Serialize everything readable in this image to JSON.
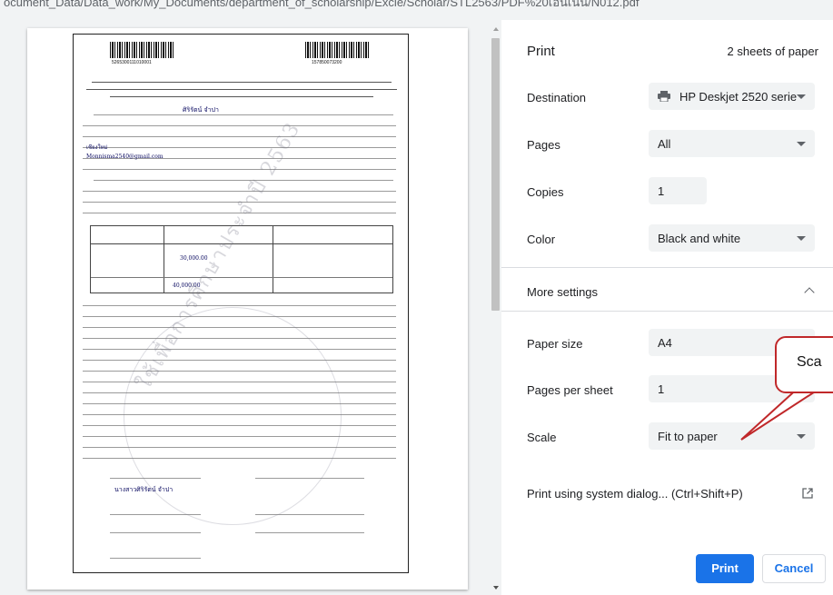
{
  "url_bar": {
    "text": "ocument_Data/Data_work/My_Documents/department_of_scholarship/Excle/Scholar/STL2563/PDF%20เอนเนน/N012.pdf"
  },
  "preview": {
    "barcode_left_number": "5265300111010001",
    "barcode_right_number": "157850073200",
    "watermark_text": "ใช้เพื่อการศึกษาประจำปี 2563",
    "handwritten": {
      "name": "ศิริรัตน์ จำปา",
      "email": "Monnisma2540@gmail.com",
      "amount_1": "30,000.00",
      "amount_2": "40,000.00",
      "signature": "นางสาวศิริรัตน์ จำปา",
      "district": "เชียงใหม่"
    }
  },
  "print_panel": {
    "title": "Print",
    "sheets": "2 sheets of paper",
    "destination": {
      "label": "Destination",
      "value": "HP Deskjet 2520 serie"
    },
    "pages": {
      "label": "Pages",
      "value": "All"
    },
    "copies": {
      "label": "Copies",
      "value": "1"
    },
    "color": {
      "label": "Color",
      "value": "Black and white"
    },
    "more_settings": {
      "label": "More settings"
    },
    "paper_size": {
      "label": "Paper size",
      "value": "A4"
    },
    "pages_per_sheet": {
      "label": "Pages per sheet",
      "value": "1"
    },
    "scale": {
      "label": "Scale",
      "value": "Fit to paper"
    },
    "system_dialog": {
      "label": "Print using system dialog... (Ctrl+Shift+P)"
    },
    "buttons": {
      "print": "Print",
      "cancel": "Cancel"
    }
  },
  "callout": {
    "text": "Sca"
  },
  "colors": {
    "accent": "#1a73e8",
    "callout_border": "#c0282a",
    "control_bg": "#f1f3f4",
    "divider": "#dadce0"
  },
  "icons": {
    "destination": "printer-icon",
    "dropdown": "chevron-down-icon",
    "more_settings": "chevron-up-icon",
    "system_dialog": "open-in-new-icon"
  }
}
